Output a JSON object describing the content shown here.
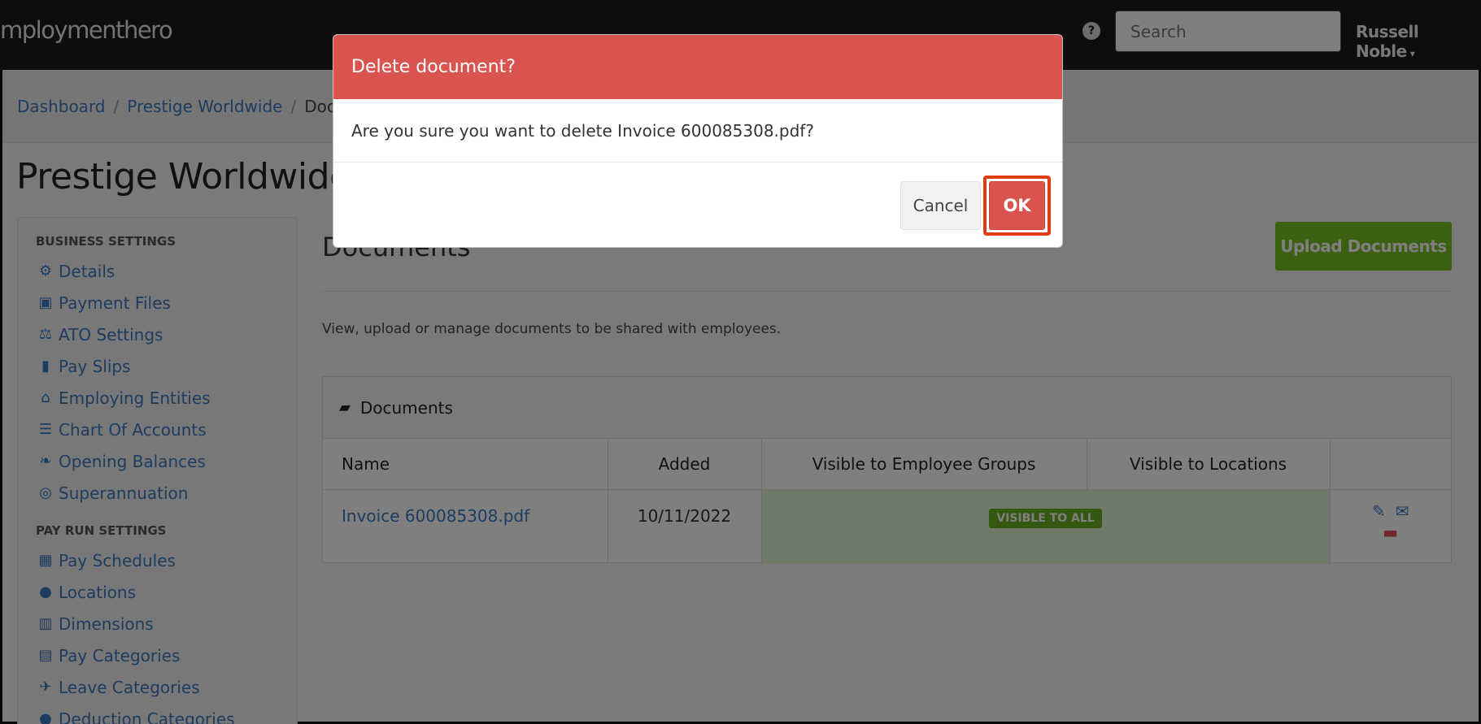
{
  "header": {
    "logo_text": "mploymenthero",
    "help_icon": "?",
    "search_placeholder": "Search",
    "user_name": "Russell Noble",
    "user_caret": "▾"
  },
  "breadcrumb": {
    "items": [
      "Dashboard",
      "Prestige Worldwide",
      "Docu"
    ],
    "separator": "/"
  },
  "page_title": "Prestige Worldwide",
  "sidebar": {
    "business_settings_label": "BUSINESS SETTINGS",
    "business_items": [
      {
        "label": "Details",
        "icon": "gear-icon"
      },
      {
        "label": "Payment Files",
        "icon": "floppy-icon"
      },
      {
        "label": "ATO Settings",
        "icon": "scales-icon"
      },
      {
        "label": "Pay Slips",
        "icon": "file-icon"
      },
      {
        "label": "Employing Entities",
        "icon": "bank-icon"
      },
      {
        "label": "Chart Of Accounts",
        "icon": "list-icon"
      },
      {
        "label": "Opening Balances",
        "icon": "leaf-icon"
      },
      {
        "label": "Superannuation",
        "icon": "lifebuoy-icon"
      }
    ],
    "pay_run_settings_label": "PAY RUN SETTINGS",
    "pay_run_items": [
      {
        "label": "Pay Schedules",
        "icon": "calendar-icon"
      },
      {
        "label": "Locations",
        "icon": "globe-icon"
      },
      {
        "label": "Dimensions",
        "icon": "bar-chart-icon"
      },
      {
        "label": "Pay Categories",
        "icon": "money-icon"
      },
      {
        "label": "Leave Categories",
        "icon": "plane-icon"
      },
      {
        "label": "Deduction Categories",
        "icon": "circle-icon"
      }
    ]
  },
  "main": {
    "title": "Documents",
    "upload_button": "Upload Documents",
    "description": "View, upload or manage documents to be shared with employees.",
    "panel_title": "Documents",
    "table": {
      "columns": [
        "Name",
        "Added",
        "Visible to Employee Groups",
        "Visible to Locations",
        ""
      ],
      "rows": [
        {
          "name": "Invoice 600085308.pdf",
          "added": "10/11/2022",
          "visibility": "VISIBLE TO ALL"
        }
      ]
    }
  },
  "modal": {
    "title": "Delete document?",
    "message": "Are you sure you want to delete Invoice 600085308.pdf?",
    "cancel_label": "Cancel",
    "ok_label": "OK"
  },
  "colors": {
    "topbar": "#1c1a1a",
    "link": "#3a78c0",
    "danger": "#d9534f",
    "success": "#78c025",
    "highlight": "#e03d12"
  }
}
